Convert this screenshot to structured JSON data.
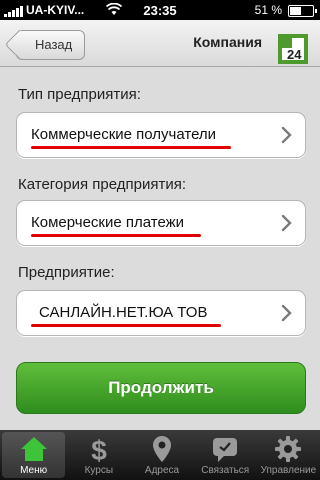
{
  "status": {
    "carrier": "UA-KYIV...",
    "time": "23:35",
    "battery": "51 %",
    "battery_level": 0.51
  },
  "nav": {
    "back_label": "Назад",
    "title": "Компания",
    "logo_text": "24"
  },
  "form": {
    "fields": [
      {
        "label": "Тип предприятия:",
        "value": "Коммерческие получатели"
      },
      {
        "label": "Категория предприятия:",
        "value": "Комерческие платежи"
      },
      {
        "label": "Предприятие:",
        "value": "САНЛАЙН.НЕТ.ЮА ТОВ"
      }
    ],
    "continue_label": "Продолжить"
  },
  "tabs": [
    {
      "label": "Меню",
      "icon": "home-icon",
      "active": true
    },
    {
      "label": "Курсы",
      "icon": "dollar-icon",
      "active": false
    },
    {
      "label": "Адреса",
      "icon": "location-pin-icon",
      "active": false
    },
    {
      "label": "Связаться",
      "icon": "chat-icon",
      "active": false
    },
    {
      "label": "Управление",
      "icon": "gear-icon",
      "active": false
    }
  ],
  "colors": {
    "accent_green": "#3a9a24",
    "underline_red": "#e00000"
  }
}
